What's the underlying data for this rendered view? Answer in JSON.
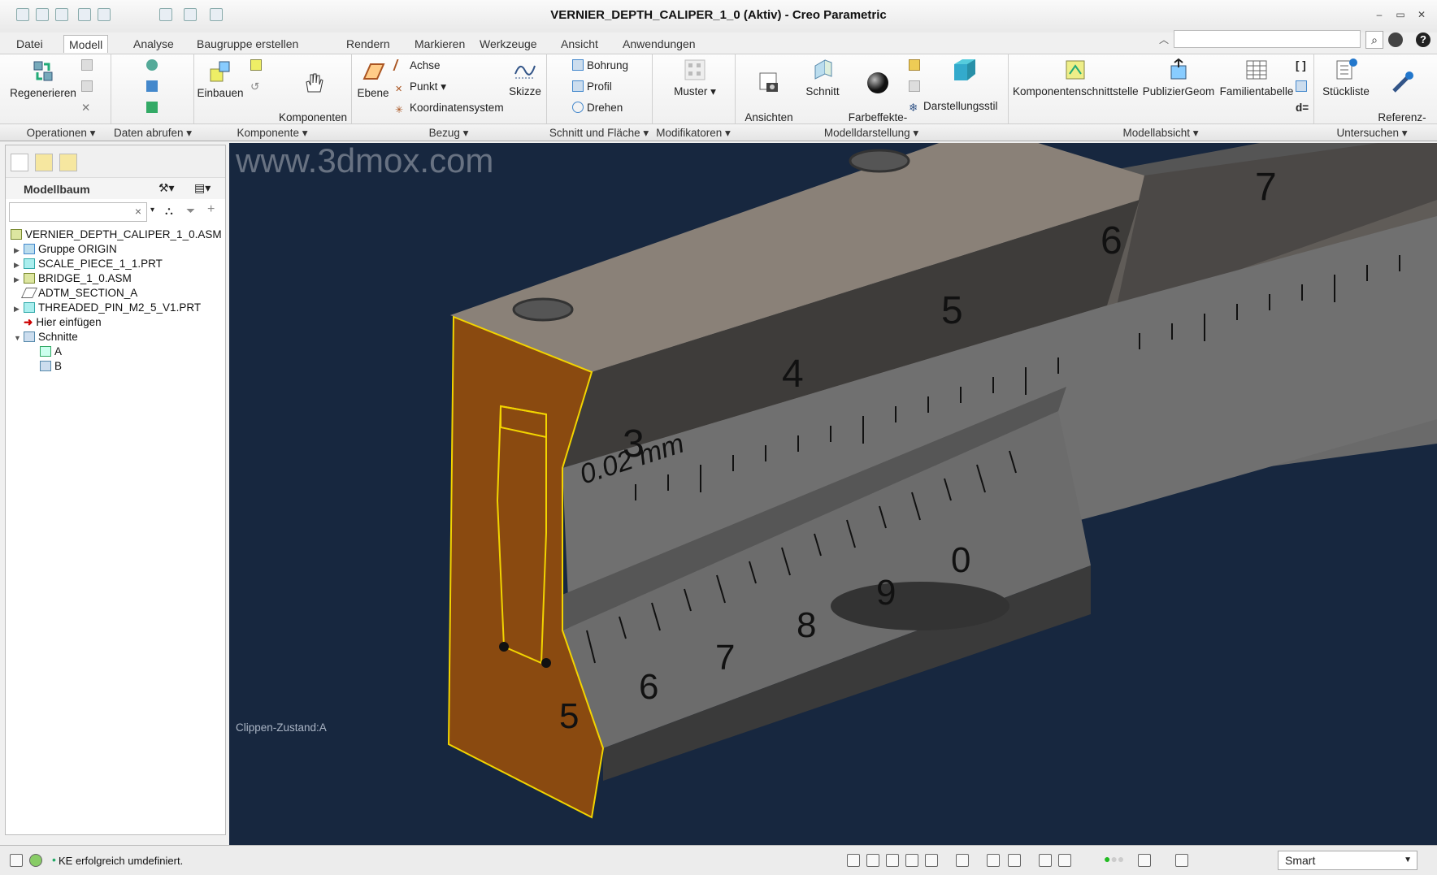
{
  "window": {
    "title": "VERNIER_DEPTH_CALIPER_1_0 (Aktiv) - Creo Parametric"
  },
  "tabs": [
    {
      "label": "Datei"
    },
    {
      "label": "Modell"
    },
    {
      "label": "Analyse"
    },
    {
      "label": "Baugruppe erstellen"
    },
    {
      "label": "Rendern"
    },
    {
      "label": "Markieren"
    },
    {
      "label": "Werkzeuge"
    },
    {
      "label": "Ansicht"
    },
    {
      "label": "Anwendungen"
    }
  ],
  "ribbon": {
    "regenerate": "Regenerieren",
    "assemble": "Einbauen",
    "drag_components": "Komponenten\nziehen",
    "plane": "Ebene",
    "axis": "Achse",
    "point": "Punkt",
    "coord_system": "Koordinatensystem",
    "sketch": "Skizze",
    "hole": "Bohrung",
    "profile": "Profil",
    "revolve": "Drehen",
    "pattern": "Muster",
    "manage_views": "Ansichten\nverwalten",
    "section": "Schnitt",
    "appearance_gallery": "Farbeffekte-\nGalerie",
    "display_style": "Darstellungsstil",
    "component_interface": "Komponentenschnittstelle",
    "publish_geom": "PublizierGeom",
    "family_table": "Familientabelle",
    "bom": "Stückliste",
    "reference_viewer": "Referenz-\nViewer",
    "relations": "d="
  },
  "groups": [
    {
      "label": "Operationen ▾"
    },
    {
      "label": "Daten abrufen ▾"
    },
    {
      "label": "Komponente ▾"
    },
    {
      "label": "Bezug ▾"
    },
    {
      "label": "Schnitt und Fläche ▾"
    },
    {
      "label": "Modifikatoren ▾"
    },
    {
      "label": "Modelldarstellung ▾"
    },
    {
      "label": "Modellabsicht ▾"
    },
    {
      "label": "Untersuchen ▾"
    }
  ],
  "model_tree": {
    "title": "Modellbaum",
    "filter_clear": "×",
    "items": [
      {
        "label": "VERNIER_DEPTH_CALIPER_1_0.ASM"
      },
      {
        "label": "Gruppe ORIGIN"
      },
      {
        "label": "SCALE_PIECE_1_1.PRT"
      },
      {
        "label": "BRIDGE_1_0.ASM"
      },
      {
        "label": "ADTM_SECTION_A"
      },
      {
        "label": "THREADED_PIN_M2_5_V1.PRT"
      },
      {
        "label": "Hier einfügen"
      },
      {
        "label": "Schnitte"
      },
      {
        "label": "A"
      },
      {
        "label": "B"
      }
    ]
  },
  "viewport": {
    "clip_state": "Clippen-Zustand:A",
    "background": "#1a2a44",
    "section_color": "#8a4a10",
    "main_scale_numbers": [
      "3",
      "4",
      "5",
      "6",
      "7"
    ],
    "vernier_numbers": [
      "5",
      "6",
      "7",
      "8",
      "9",
      "0"
    ],
    "engraving": "0.02 mm"
  },
  "status": {
    "message": "KE erfolgreich umdefiniert.",
    "filter": "Smart"
  },
  "watermark": "www.3dmox.com"
}
